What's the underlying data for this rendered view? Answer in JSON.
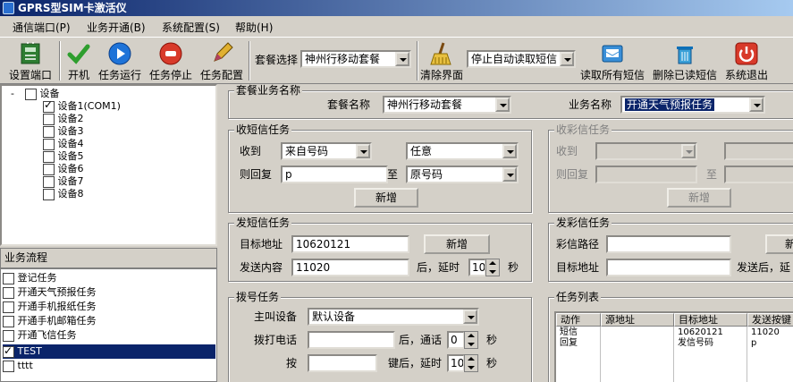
{
  "window": {
    "title": "GPRS型SIM卡激活仪"
  },
  "menu": [
    "通信端口(P)",
    "业务开通(B)",
    "系统配置(S)",
    "帮助(H)"
  ],
  "toolbar": {
    "setup_port": "设置端口",
    "power_on": "开机",
    "run_task": "任务运行",
    "stop_task": "任务停止",
    "task_config": "任务配置",
    "package_select_label": "套餐选择",
    "package_select_value": "神州行移动套餐",
    "clear_ui": "清除界面",
    "sms_mode_value": "停止自动读取短信",
    "read_all_sms": "读取所有短信",
    "delete_read_sms": "删除已读短信",
    "exit": "系统退出"
  },
  "device_tree": {
    "root_expander": "-",
    "root": "设备",
    "devices": [
      {
        "label": "设备1(COM1)",
        "checked": true
      },
      {
        "label": "设备2",
        "checked": false
      },
      {
        "label": "设备3",
        "checked": false
      },
      {
        "label": "设备4",
        "checked": false
      },
      {
        "label": "设备5",
        "checked": false
      },
      {
        "label": "设备6",
        "checked": false
      },
      {
        "label": "设备7",
        "checked": false
      },
      {
        "label": "设备8",
        "checked": false
      }
    ]
  },
  "business_flow": {
    "title": "业务流程",
    "items": [
      {
        "label": "登记任务",
        "checked": false
      },
      {
        "label": "开通天气预报任务",
        "checked": false
      },
      {
        "label": "开通手机报纸任务",
        "checked": false
      },
      {
        "label": "开通手机邮箱任务",
        "checked": false
      },
      {
        "label": "开通飞信任务",
        "checked": false
      },
      {
        "label": "TEST",
        "checked": true,
        "selected": true
      },
      {
        "label": "tttt",
        "checked": false
      }
    ]
  },
  "package_group": {
    "title": "套餐业务名称",
    "package_label": "套餐名称",
    "package_value": "神州行移动套餐",
    "business_label": "业务名称",
    "business_value": "开通天气预报任务"
  },
  "receive_sms": {
    "title": "收短信任务",
    "receive_label": "收到",
    "from_value": "来自号码",
    "match_value": "任意",
    "reply_label": "则回复",
    "reply_value": "p",
    "to_label": "至",
    "to_value": "原号码",
    "add_button": "新增"
  },
  "receive_mms": {
    "title": "收彩信任务",
    "receive_label": "收到",
    "reply_label": "则回复",
    "to_label": "至",
    "add_button": "新增"
  },
  "send_sms": {
    "title": "发短信任务",
    "target_label": "目标地址",
    "target_value": "10620121",
    "add_button": "新增",
    "content_label": "发送内容",
    "content_value": "11020",
    "delay_prefix": "后，延时",
    "delay_value": "10",
    "delay_unit": "秒"
  },
  "send_mms": {
    "title": "发彩信任务",
    "path_label": "彩信路径",
    "add_button_partial": "新",
    "target_label": "目标地址",
    "delay_prefix_partial": "发送后，延"
  },
  "dial": {
    "title": "拨号任务",
    "caller_label": "主叫设备",
    "caller_value": "默认设备",
    "phone_label": "拨打电话",
    "talk_prefix": "后，通话",
    "talk_value": "0",
    "talk_unit": "秒",
    "key_label": "按",
    "key_delay_prefix": "键后，延时",
    "key_delay_value": "10",
    "key_delay_unit": "秒"
  },
  "task_list": {
    "title": "任务列表",
    "columns": [
      "动作",
      "源地址",
      "目标地址",
      "发送按键"
    ],
    "rows": [
      [
        "短信",
        "",
        "10620121",
        "11020"
      ],
      [
        "回复",
        "",
        "发信号码",
        "p"
      ]
    ]
  }
}
